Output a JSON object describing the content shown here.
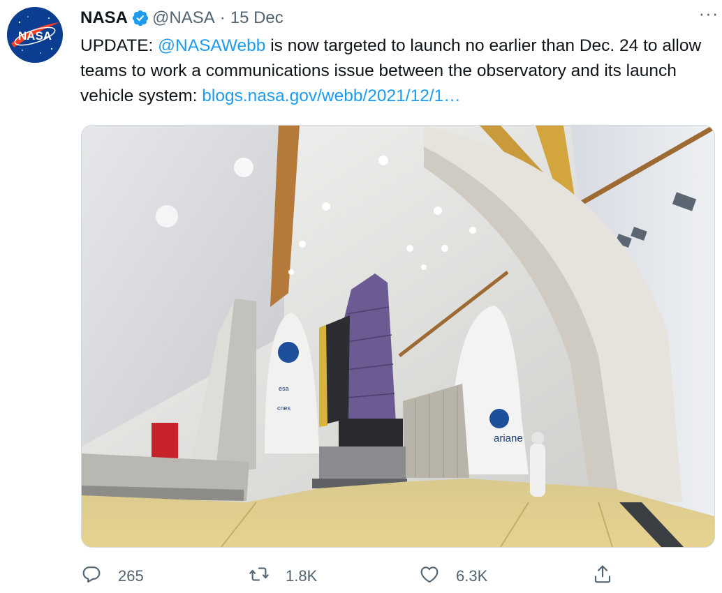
{
  "tweet": {
    "author_name": "NASA",
    "handle": "@NASA",
    "separator": "·",
    "date": "15 Dec",
    "more_label": "···",
    "avatar_text": "NASA",
    "text_prefix": "UPDATE: ",
    "mention": "@NASAWebb",
    "text_body": " is now targeted to launch no earlier than Dec. 24 to allow teams to work a communications issue between the observatory and its launch vehicle system: ",
    "link_text": "blogs.nasa.gov/webb/2021/12/1…"
  },
  "media": {
    "fairing_labels": [
      "ariane",
      "esa",
      "cnes"
    ]
  },
  "actions": {
    "reply_count": "265",
    "retweet_count": "1.8K",
    "like_count": "6.3K"
  },
  "colors": {
    "link": "#1d9bf0",
    "secondary": "#536471",
    "verified": "#1d9bf0",
    "nasa_blue": "#0b3d91",
    "nasa_red": "#fc3d21"
  }
}
